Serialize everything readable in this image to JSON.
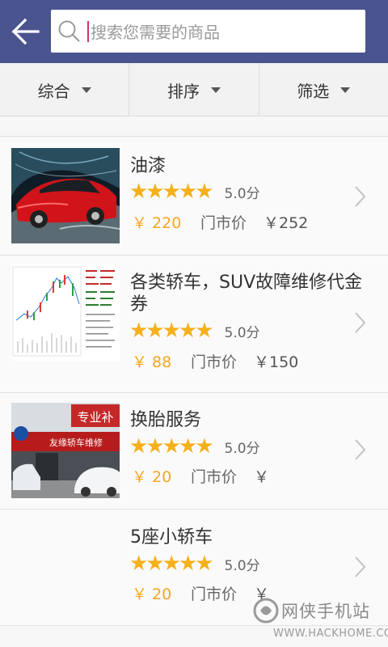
{
  "header": {
    "back_icon": "arrow-left-icon",
    "search": {
      "icon": "search-icon",
      "placeholder": "搜索您需要的商品"
    },
    "colors": {
      "bar": "#4a548f",
      "caret": "#d6336c"
    }
  },
  "filters": [
    {
      "label": "综合",
      "icon": "triangle-down-icon"
    },
    {
      "label": "排序",
      "icon": "triangle-down-icon"
    },
    {
      "label": "筛选",
      "icon": "triangle-down-icon"
    }
  ],
  "products": [
    {
      "title": "油漆",
      "stars": "★★★★★",
      "rating": "5.0分",
      "price": "￥ 220",
      "market_label": "门市价",
      "market_price": "￥252",
      "image": "red-sports-car"
    },
    {
      "title": "各类轿车，SUV故障维修代金券",
      "stars": "★★★★★",
      "rating": "5.0分",
      "price": "￥ 88",
      "market_label": "门市价",
      "market_price": "￥150",
      "image": "stock-chart"
    },
    {
      "title": "换胎服务",
      "stars": "★★★★★",
      "rating": "5.0分",
      "price": "￥ 20",
      "market_label": "门市价",
      "market_price": "￥",
      "image": "repair-shop"
    },
    {
      "title": "5座小轿车",
      "stars": "★★★★★",
      "rating": "5.0分",
      "price": "￥ 20",
      "market_label": "门市价",
      "market_price": "￥",
      "image": ""
    }
  ],
  "thumb_texts": {
    "shop_sign": "专业补",
    "shop_banner": "友缘轿车维修"
  },
  "watermark": {
    "name": "网侠手机站",
    "url": "WWW.HACKHOME.COM"
  },
  "accent": {
    "price": "#f5a623",
    "star": "#f5b01c"
  }
}
